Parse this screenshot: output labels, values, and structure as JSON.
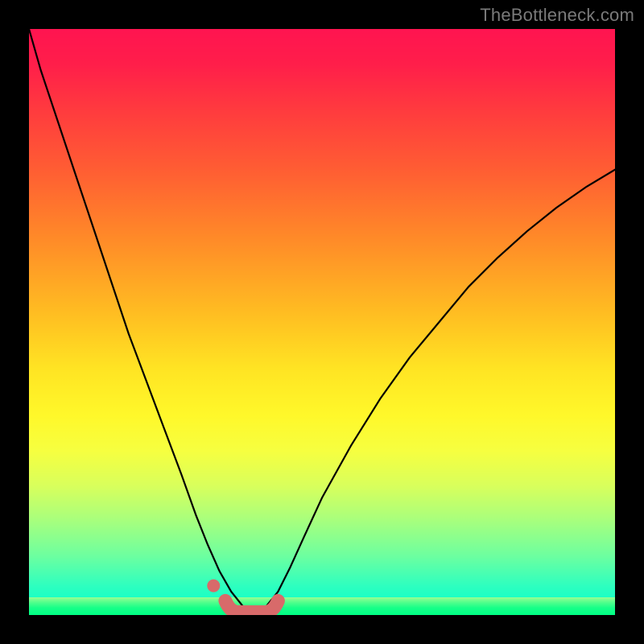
{
  "watermark": "TheBottleneck.com",
  "colors": {
    "background_black": "#000000",
    "curve": "#000000",
    "accent_pink": "#d86a6a",
    "gradient_top": "#ff1450",
    "gradient_bottom": "#00ff85"
  },
  "chart_data": {
    "type": "line",
    "title": "",
    "xlabel": "",
    "ylabel": "",
    "xlim": [
      0,
      1
    ],
    "ylim": [
      0,
      1
    ],
    "series": [
      {
        "name": "bottleneck-curve",
        "x": [
          0.0,
          0.02,
          0.05,
          0.08,
          0.11,
          0.14,
          0.17,
          0.2,
          0.23,
          0.26,
          0.285,
          0.305,
          0.325,
          0.345,
          0.365,
          0.385,
          0.405,
          0.425,
          0.445,
          0.47,
          0.5,
          0.55,
          0.6,
          0.65,
          0.7,
          0.75,
          0.8,
          0.85,
          0.9,
          0.95,
          1.0
        ],
        "y": [
          1.0,
          0.93,
          0.84,
          0.75,
          0.66,
          0.57,
          0.48,
          0.4,
          0.32,
          0.24,
          0.17,
          0.12,
          0.075,
          0.04,
          0.015,
          0.005,
          0.015,
          0.04,
          0.08,
          0.135,
          0.2,
          0.29,
          0.37,
          0.44,
          0.5,
          0.56,
          0.61,
          0.655,
          0.695,
          0.73,
          0.76
        ]
      }
    ],
    "highlight": {
      "name": "optimal-zone",
      "note": "pink flat segment at curve minimum",
      "x_range": [
        0.335,
        0.425
      ],
      "y": 0.005,
      "leading_dot": {
        "x": 0.315,
        "y": 0.05
      }
    },
    "annotations": []
  }
}
